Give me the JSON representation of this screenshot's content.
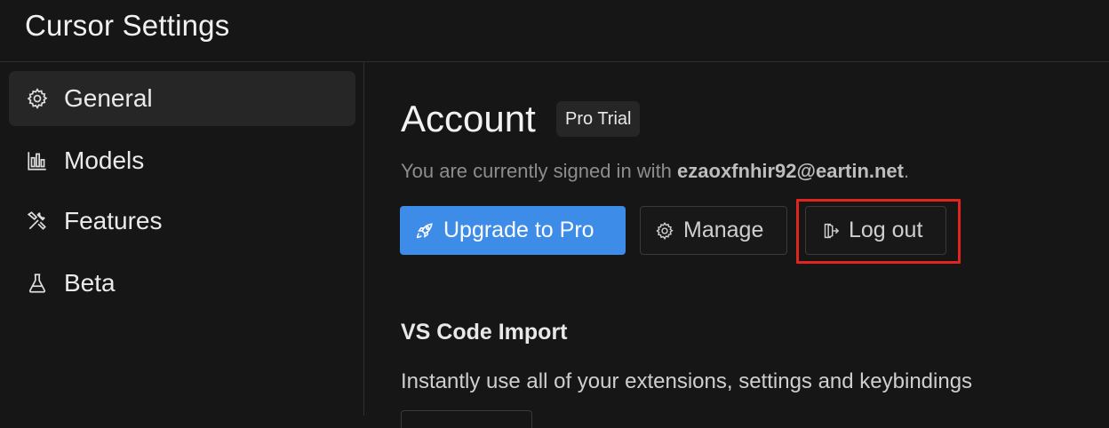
{
  "window": {
    "title": "Cursor Settings"
  },
  "sidebar": {
    "items": [
      {
        "label": "General",
        "icon": "gear-icon",
        "active": true
      },
      {
        "label": "Models",
        "icon": "bar-chart-icon",
        "active": false
      },
      {
        "label": "Features",
        "icon": "tools-icon",
        "active": false
      },
      {
        "label": "Beta",
        "icon": "flask-icon",
        "active": false
      }
    ]
  },
  "account": {
    "title": "Account",
    "badge": "Pro Trial",
    "signed_in_prefix": "You are currently signed in with ",
    "email": "ezaoxfnhir92@eartin.net",
    "signed_in_suffix": ".",
    "buttons": {
      "upgrade": "Upgrade to Pro",
      "manage": "Manage",
      "logout": "Log out"
    }
  },
  "vscode_import": {
    "title": "VS Code Import",
    "description": "Instantly use all of your extensions, settings and keybindings"
  },
  "colors": {
    "accent": "#3c8ce8",
    "highlight": "#e0251f",
    "background": "#161616"
  }
}
